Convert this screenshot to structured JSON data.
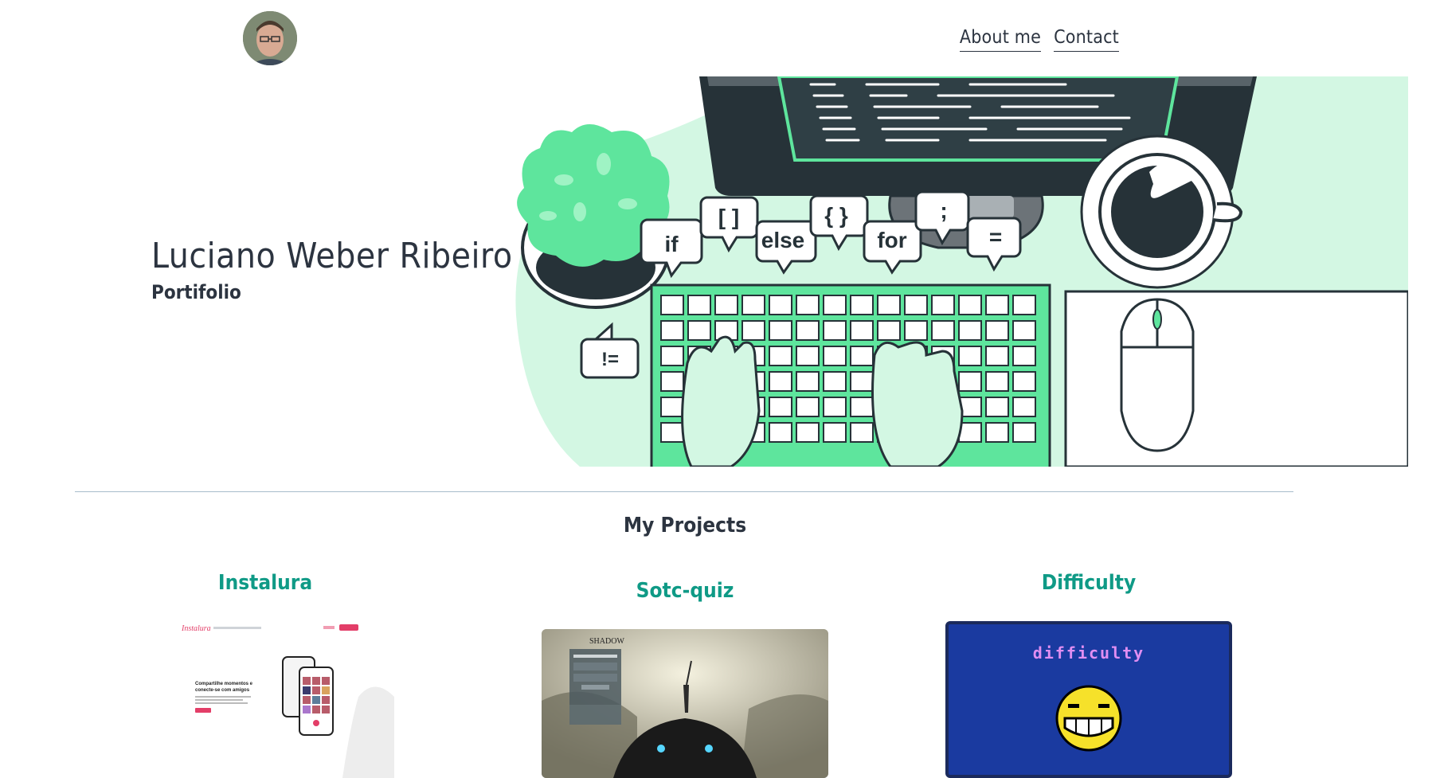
{
  "header": {
    "nav": [
      {
        "label": "About me"
      },
      {
        "label": "Contact"
      }
    ]
  },
  "hero": {
    "name": "Luciano Weber Ribeiro",
    "subtitle": "Portifolio",
    "bubbles": [
      "if",
      "[ ]",
      "else",
      "{ }",
      "for",
      ";",
      "=",
      "!="
    ]
  },
  "projects_section": {
    "title": "My Projects",
    "items": [
      {
        "title": "Instalura",
        "thumb": {
          "logo": "Instalura",
          "headline_1": "Compartilhe momentos e",
          "headline_2": "conecte-se com amigos"
        }
      },
      {
        "title": "Sotc-quiz",
        "thumb": {
          "logo": "SHADOW"
        }
      },
      {
        "title": "Difficulty",
        "thumb": {
          "banner": "difficulty"
        }
      }
    ]
  },
  "colors": {
    "accent_green": "#5ee59d",
    "light_green": "#d3f7e3",
    "dark": "#263238",
    "project_title": "#0f9a86",
    "difficulty_bg": "#1a3aa0",
    "difficulty_text": "#e08ef2"
  }
}
